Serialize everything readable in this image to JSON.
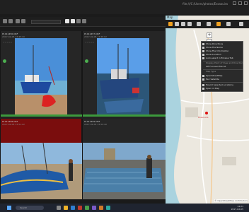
{
  "window": {
    "url_text": "file:///C:/Users/photos/Essaouira",
    "minimize": "–",
    "maximize": "□",
    "close": "✕"
  },
  "toolbar": {
    "search_placeholder": "Search",
    "icons": [
      "back-icon",
      "forward-icon",
      "sort-icon",
      "filter-icon",
      "star-icon",
      "flag-icon",
      "text-icon",
      "view-icon"
    ]
  },
  "tiles": [
    {
      "name": "P1011456.ORF",
      "date": "2017-02-05 13:45:10",
      "dims": "4608x3456"
    },
    {
      "name": "P1011457.ORF",
      "date": "2017-02-05 13:46:02",
      "dims": "4608x3456"
    },
    {
      "name": "P1011458.ORF",
      "date": "2017-02-05 13:51:22",
      "dims": "4608x3456"
    },
    {
      "name": "P1011459.ORF",
      "date": "2017-02-05 13:52:40",
      "dims": "4608x3456"
    }
  ],
  "map": {
    "title": "Map",
    "menu": [
      {
        "label": "Show Directions",
        "checked": false
      },
      {
        "label": "Show File Name",
        "checked": false
      },
      {
        "label": "Show File Information",
        "checked": true
      },
      {
        "label": "Show Location",
        "checked": true
      },
      {
        "label": "Auto-select in Browse Tab",
        "checked": true
      }
    ],
    "menu_section": "Display Point of View and Direction",
    "menu_options": "Off   Focused File   All",
    "map_type_heading": "Map Type",
    "map_types": [
      {
        "label": "OpenStreetMap",
        "checked": true
      },
      {
        "label": "Esri Satellite",
        "checked": false
      }
    ],
    "map_extra": [
      {
        "label": "Export Selected Locations",
        "checked": false
      },
      {
        "label": "Open in Map",
        "checked": false
      }
    ],
    "place_label": "Essaouira",
    "copyright": "© OpenStreetMap contributors"
  },
  "taskbar": {
    "search_placeholder": "Search",
    "time": "14:21",
    "date": "2017-02-05"
  },
  "colors": {
    "accent_green": "#3c9a3c",
    "selected_red": "#7a0d0d",
    "map_land": "#ece8df",
    "map_sea": "#aad3df"
  }
}
